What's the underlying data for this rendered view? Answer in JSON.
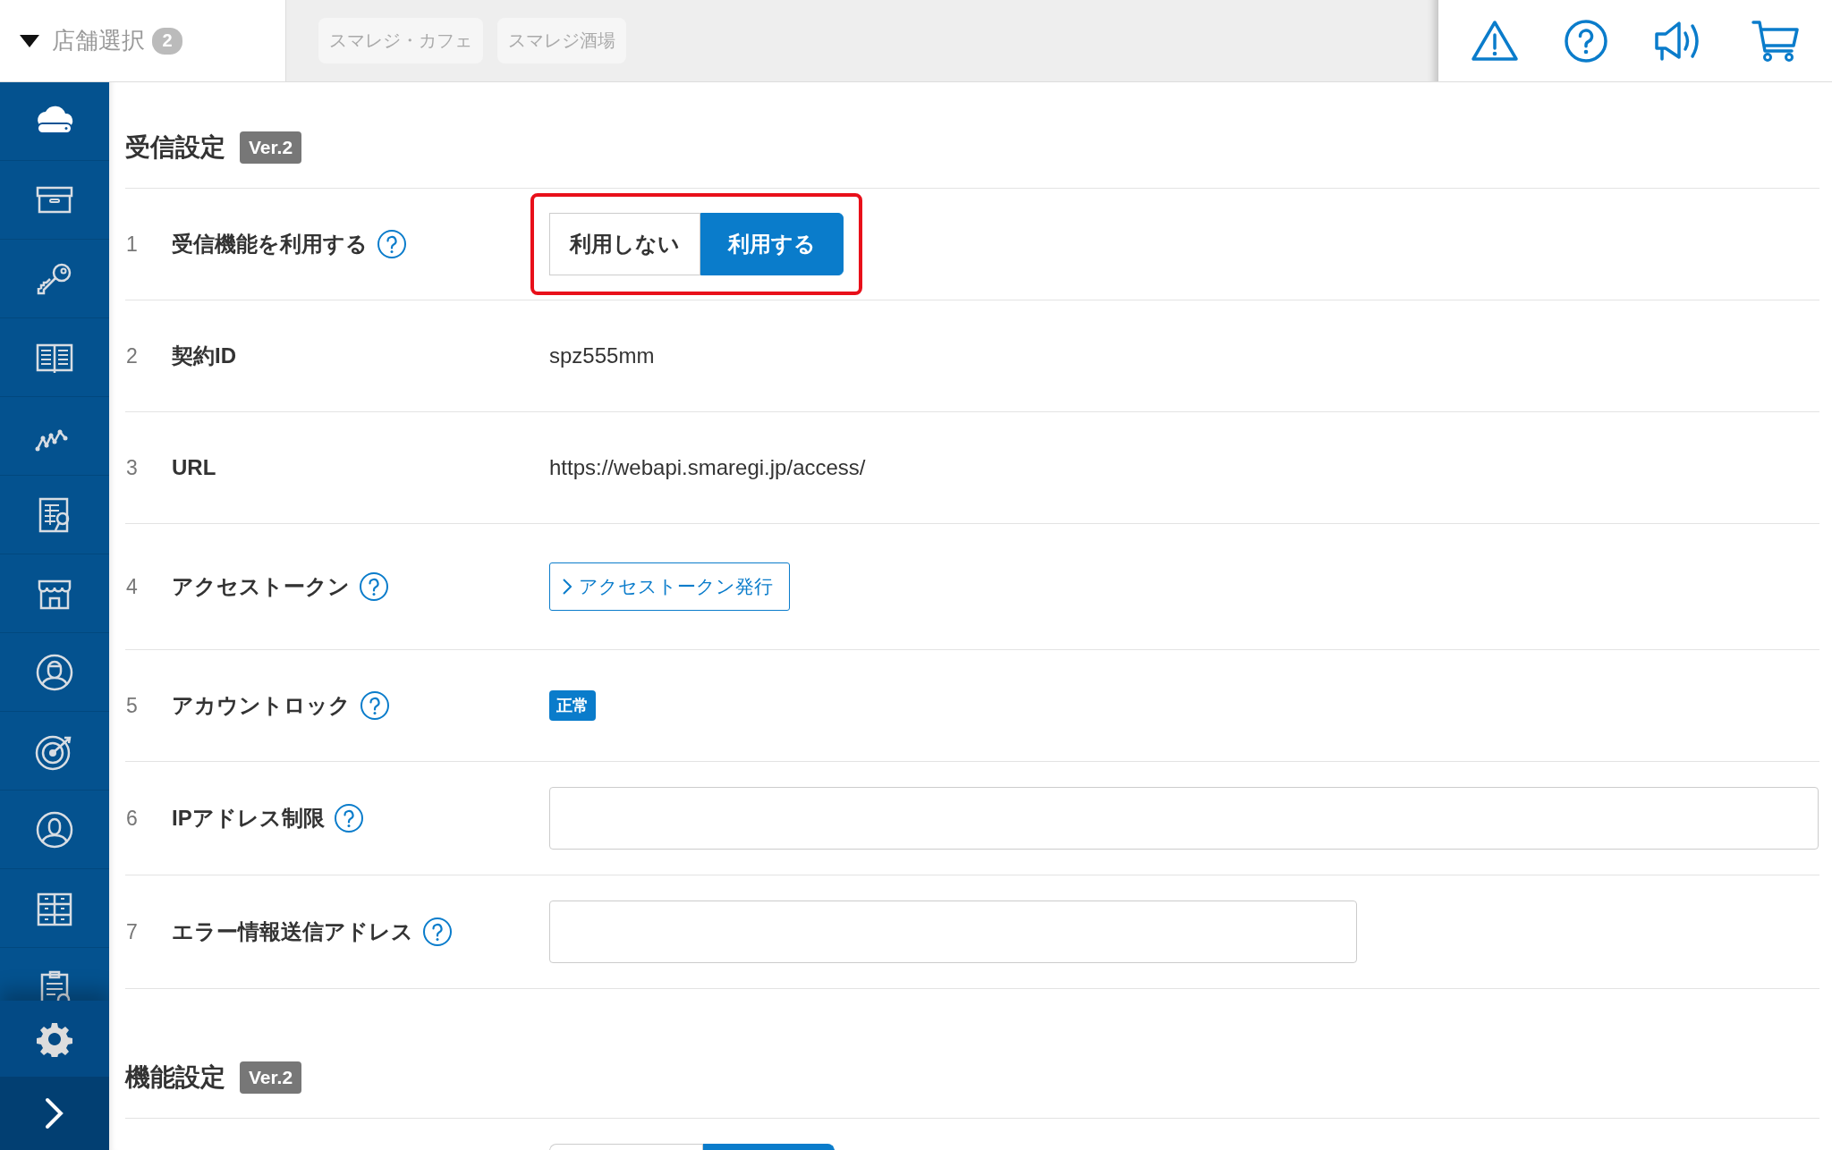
{
  "store_selector": {
    "label": "店舗選択",
    "count": "2"
  },
  "store_tabs": [
    {
      "label": "スマレジ・カフェ"
    },
    {
      "label": "スマレジ酒場"
    }
  ],
  "sections": [
    {
      "title": "受信設定",
      "version": "Ver.2",
      "rows": [
        {
          "number": "1",
          "label": "受信機能を利用する",
          "help": true,
          "kind": "toggle",
          "highlighted": true,
          "options": [
            {
              "label": "利用しない",
              "selected": false
            },
            {
              "label": "利用する",
              "selected": true
            }
          ]
        },
        {
          "number": "2",
          "label": "契約ID",
          "help": false,
          "kind": "text",
          "value": "spz555mm"
        },
        {
          "number": "3",
          "label": "URL",
          "help": false,
          "kind": "text",
          "value": "https://webapi.smaregi.jp/access/"
        },
        {
          "number": "4",
          "label": "アクセストークン",
          "help": true,
          "kind": "link_button",
          "value": "アクセストークン発行"
        },
        {
          "number": "5",
          "label": "アカウントロック",
          "help": true,
          "kind": "badge",
          "value": "正常"
        },
        {
          "number": "6",
          "label": "IPアドレス制限",
          "help": true,
          "kind": "input",
          "wide": true
        },
        {
          "number": "7",
          "label": "エラー情報送信アドレス",
          "help": true,
          "kind": "input",
          "wide": false
        }
      ]
    },
    {
      "title": "機能設定",
      "version": "Ver.2",
      "rows": [
        {
          "kind": "toggle_partial"
        }
      ]
    }
  ]
}
